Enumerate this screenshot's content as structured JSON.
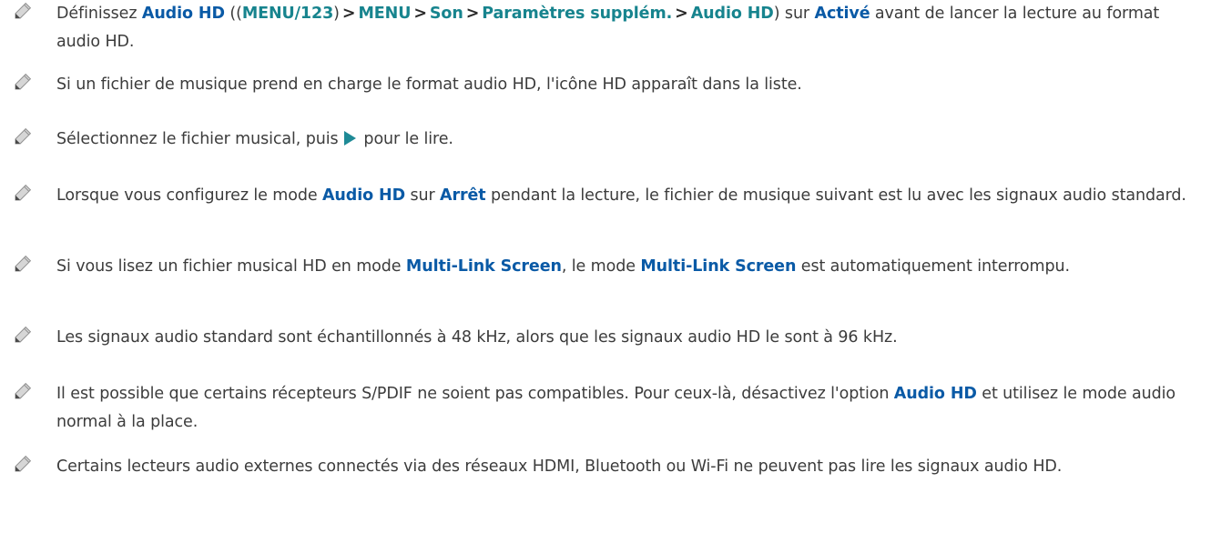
{
  "icons": {
    "note": "pencil-icon",
    "play": "play-icon"
  },
  "colors": {
    "keyword": "#0a5aa6",
    "remote_key": "#17848e",
    "play": "#1e8a96",
    "text": "#3c3c3c"
  },
  "notes": [
    {
      "p1": "Définissez ",
      "k1": "Audio HD",
      "p2": " ((",
      "path0": "MENU/123",
      "p3": ")",
      "sep": ">",
      "path1": "MENU",
      "path2": "Son",
      "path3": "Paramètres supplém.",
      "path4": "Audio HD",
      "p4": ") sur ",
      "k2": "Activé",
      "p5": " avant de lancer la lecture au format audio HD."
    },
    {
      "p1": "Si un fichier de musique prend en charge le format audio HD, l'icône HD apparaît dans la liste."
    },
    {
      "p1": "Sélectionnez le fichier musical, puis ",
      "p2": " pour le lire."
    },
    {
      "p1": "Lorsque vous configurez le mode ",
      "k1": "Audio HD",
      "p2": " sur ",
      "k2": "Arrêt",
      "p3": " pendant la lecture, le fichier de musique suivant est lu avec les signaux audio standard."
    },
    {
      "p1": "Si vous lisez un fichier musical HD en mode ",
      "k1": "Multi-Link Screen",
      "p2": ", le mode ",
      "k2": "Multi-Link Screen",
      "p3": " est automatiquement interrompu."
    },
    {
      "p1": "Les signaux audio standard sont échantillonnés à 48 kHz, alors que les signaux audio HD le sont à 96 kHz."
    },
    {
      "p1": "Il est possible que certains récepteurs S/PDIF ne soient pas compatibles. Pour ceux-là, désactivez l'option ",
      "k1": "Audio HD",
      "p2": " et utilisez le mode audio normal à la place."
    },
    {
      "p1": "Certains lecteurs audio externes connectés via des réseaux HDMI, Bluetooth ou Wi-Fi ne peuvent pas lire les signaux audio HD."
    }
  ]
}
